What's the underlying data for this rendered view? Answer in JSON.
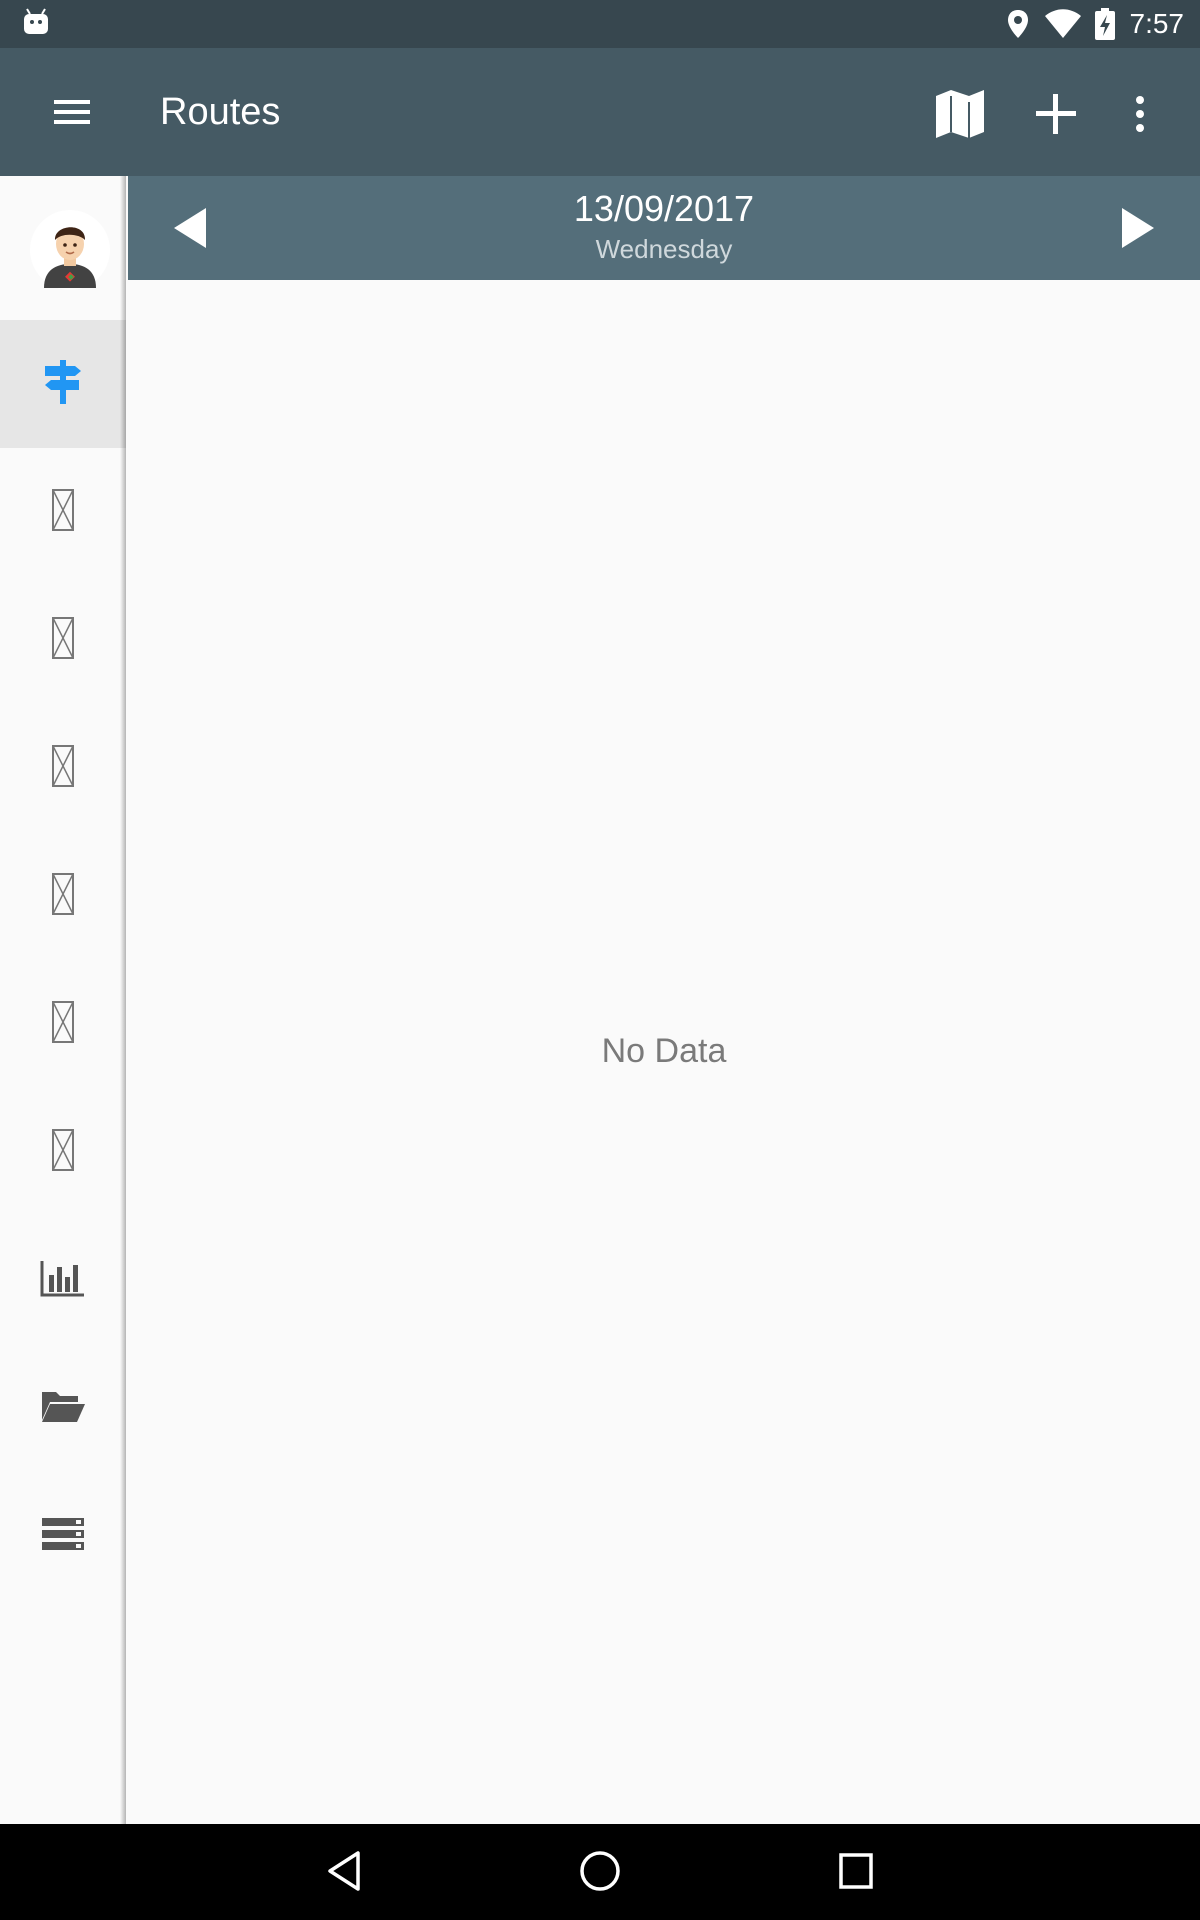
{
  "status_bar": {
    "time": "7:57",
    "icons": [
      "android-debug-icon",
      "location-icon",
      "wifi-icon",
      "battery-charging-icon"
    ]
  },
  "toolbar": {
    "title": "Routes",
    "actions": [
      "menu-icon",
      "map-icon",
      "add-icon",
      "more-vert-icon"
    ]
  },
  "date_bar": {
    "date": "13/09/2017",
    "weekday": "Wednesday"
  },
  "sidebar": {
    "items": [
      {
        "name": "routes",
        "icon": "signpost-icon",
        "active": true
      },
      {
        "name": "item-2",
        "icon": "missing-glyph-icon"
      },
      {
        "name": "item-3",
        "icon": "missing-glyph-icon"
      },
      {
        "name": "item-4",
        "icon": "missing-glyph-icon"
      },
      {
        "name": "item-5",
        "icon": "missing-glyph-icon"
      },
      {
        "name": "item-6",
        "icon": "missing-glyph-icon"
      },
      {
        "name": "item-7",
        "icon": "missing-glyph-icon"
      },
      {
        "name": "statistics",
        "icon": "bar-chart-icon"
      },
      {
        "name": "files",
        "icon": "folder-open-icon"
      },
      {
        "name": "storage",
        "icon": "storage-icon"
      }
    ],
    "accent_color": "#2196f3"
  },
  "content": {
    "empty_text": "No Data"
  },
  "colors": {
    "status_bar": "#37474f",
    "toolbar": "#455a64",
    "date_bar": "#546e7a"
  }
}
